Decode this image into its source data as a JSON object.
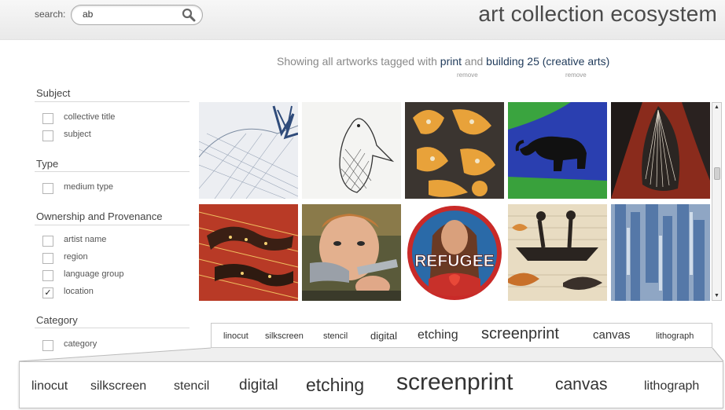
{
  "search": {
    "label": "search:",
    "value": "ab"
  },
  "site_title": "art collection ecosystem",
  "showing": {
    "prefix": "Showing all artworks tagged with",
    "tag1": "print",
    "joiner": "and",
    "tag2": "building 25 (creative arts)",
    "remove1": "remove",
    "remove2": "remove"
  },
  "facets": [
    {
      "heading": "Subject",
      "items": [
        {
          "label": "collective title",
          "checked": false
        },
        {
          "label": "subject",
          "checked": false
        }
      ]
    },
    {
      "heading": "Type",
      "items": [
        {
          "label": "medium type",
          "checked": false
        }
      ]
    },
    {
      "heading": "Ownership and Provenance",
      "items": [
        {
          "label": "artist name",
          "checked": false
        },
        {
          "label": "region",
          "checked": false
        },
        {
          "label": "language group",
          "checked": false
        },
        {
          "label": "location",
          "checked": true
        }
      ]
    },
    {
      "heading": "Category",
      "items": [
        {
          "label": "category",
          "checked": false
        }
      ]
    }
  ],
  "refugee_text": "REFUGEE",
  "tags": [
    "linocut",
    "silkscreen",
    "stencil",
    "digital",
    "etching",
    "screenprint",
    "canvas",
    "lithograph"
  ],
  "colors": {
    "tag_link": "#1f3a5a",
    "heading": "#444444",
    "border": "#c9c9c9"
  }
}
